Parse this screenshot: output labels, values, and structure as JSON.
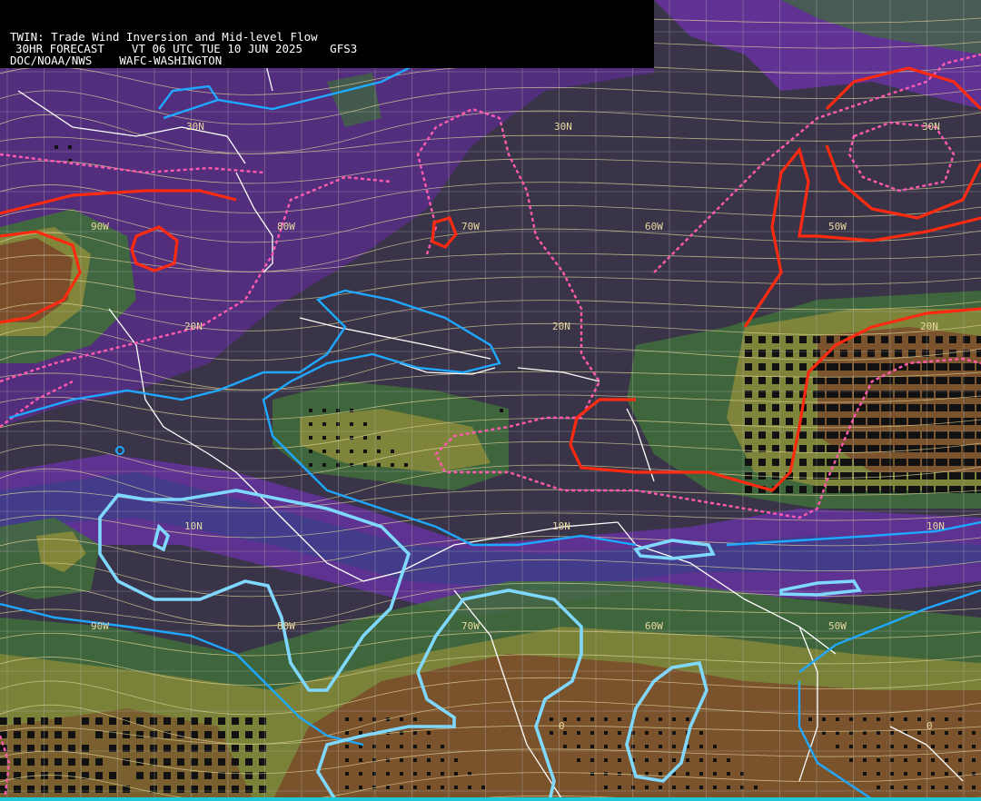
{
  "header": {
    "line1": "TWIN: Trade Wind Inversion and Mid-level Flow",
    "line2": "30HR FORECAST    VT 06 UTC TUE 10 JUN 2025    GFS3",
    "line3": "DOC/NOAA/NWS    WAFC-WASHINGTON"
  },
  "grid_labels": {
    "lat_30n": "30N",
    "lat_20n": "20N",
    "lat_10n": "10N",
    "lat_0": "0",
    "lon_90w": "90W",
    "lon_80w": "80W",
    "lon_70w": "70W",
    "lon_60w": "60W",
    "lon_50w": "50W"
  },
  "colors": {
    "background": "#3a3448",
    "purple_shade": "#6a32a8",
    "blue_shade": "#3c3f88",
    "green_shade": "#3f6e3a",
    "olive_shade": "#8a8a3a",
    "brown_shade": "#7a4a2a",
    "streamlines": "#e0d49a",
    "cyan_contour": "#1ea8ff",
    "bright_cyan_contour": "#7fd8ff",
    "red_contour": "#ff2a10",
    "pink_dashed_contour": "#ff5ab0",
    "coastline": "#ffffff"
  }
}
